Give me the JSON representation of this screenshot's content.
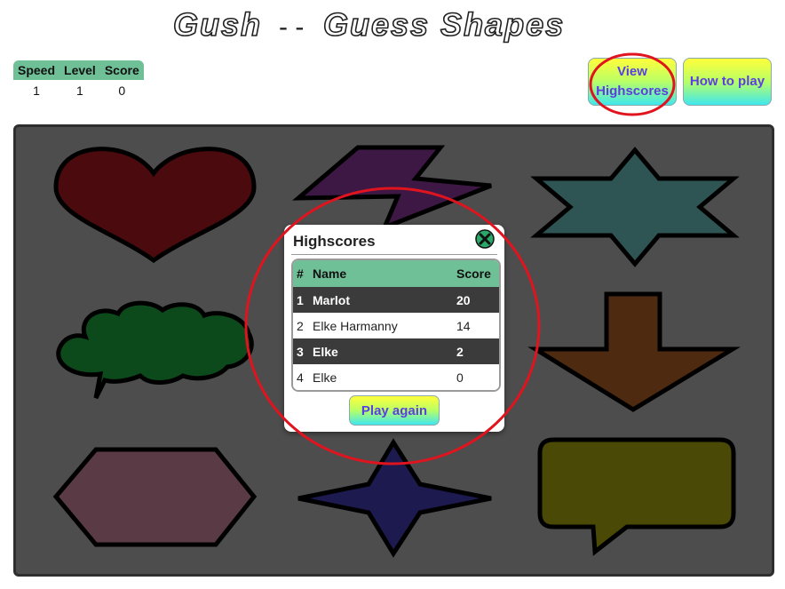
{
  "app": {
    "title_part1": "Gush",
    "separator": "- -",
    "title_part2": "Guess Shapes"
  },
  "stats": {
    "headers": [
      "Speed",
      "Level",
      "Score"
    ],
    "values": [
      "1",
      "1",
      "0"
    ]
  },
  "buttons": {
    "view_highscores": "View Highscores",
    "how_to_play": "How to play",
    "play_again": "Play again"
  },
  "highscores": {
    "title": "Highscores",
    "columns": [
      "#",
      "Name",
      "Score"
    ],
    "rows": [
      {
        "rank": "1",
        "name": "Marlot",
        "score": "20"
      },
      {
        "rank": "2",
        "name": "Elke Harmanny",
        "score": "14"
      },
      {
        "rank": "3",
        "name": "Elke",
        "score": "2"
      },
      {
        "rank": "4",
        "name": "Elke",
        "score": "0"
      }
    ]
  },
  "shapes": [
    {
      "name": "heart",
      "color": "#4a0a0e"
    },
    {
      "name": "lightning",
      "color": "#3d1844"
    },
    {
      "name": "hexagram",
      "color": "#2e5553"
    },
    {
      "name": "cloud-speech-bubble",
      "color": "#0c4a1c"
    },
    {
      "name": "down-arrow",
      "color": "#4d2a10"
    },
    {
      "name": "hexagon",
      "color": "#5a3a44"
    },
    {
      "name": "four-point-star",
      "color": "#1c1a4e"
    },
    {
      "name": "rectangular-speech-bubble",
      "color": "#4a4a06"
    }
  ],
  "colors": {
    "accent_green": "#6fbf97",
    "board": "#4d4d4d",
    "highlight_ring": "#e0141e",
    "button_text": "#5a3fe0"
  }
}
